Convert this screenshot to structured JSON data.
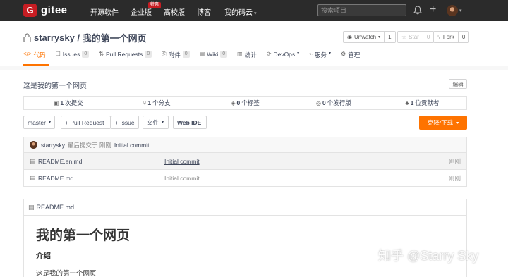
{
  "navbar": {
    "logo_glyph": "G",
    "logo_text": "gitee",
    "links": [
      "开源软件",
      "企业版",
      "高校版",
      "博客",
      "我的码云"
    ],
    "badge": "特惠",
    "search_placeholder": "搜索项目"
  },
  "repo": {
    "owner": "starrysky",
    "separator": " / ",
    "name": "我的第一个网页",
    "watch_label": "Unwatch",
    "watch_count": "1",
    "star_label": "Star",
    "star_count": "0",
    "fork_label": "Fork",
    "fork_count": "0"
  },
  "tabs": [
    {
      "label": "代码",
      "icon": "</>",
      "count": ""
    },
    {
      "label": "Issues",
      "icon": "☐",
      "count": "0"
    },
    {
      "label": "Pull Requests",
      "icon": "⇅",
      "count": "0"
    },
    {
      "label": "附件",
      "icon": "⎘",
      "count": "0"
    },
    {
      "label": "Wiki",
      "icon": "▤",
      "count": "0"
    },
    {
      "label": "统计",
      "icon": "▥",
      "count": ""
    },
    {
      "label": "DevOps",
      "icon": "⟳",
      "count": ""
    },
    {
      "label": "服务",
      "icon": "⌁",
      "count": ""
    },
    {
      "label": "管理",
      "icon": "⚙",
      "count": ""
    }
  ],
  "description": "这是我的第一个网页",
  "edit_label": "编辑",
  "stats": [
    {
      "icon": "▣",
      "value": "1",
      "label": "次提交"
    },
    {
      "icon": "⑂",
      "value": "1",
      "label": "个分支"
    },
    {
      "icon": "◈",
      "value": "0",
      "label": "个标签"
    },
    {
      "icon": "◎",
      "value": "0",
      "label": "个发行版"
    },
    {
      "icon": "♣",
      "value": "1",
      "label": "位贡献者"
    }
  ],
  "toolbar": {
    "branch": "master",
    "pull_request": "+ Pull Request",
    "issue": "+ Issue",
    "file": "文件",
    "web_ide": "Web IDE",
    "clone": "克隆/下载"
  },
  "commit": {
    "author": "starrysky",
    "meta": "最后提交于 刚刚",
    "message": "Initial commit"
  },
  "files": [
    {
      "name": "README.en.md",
      "commit": "Initial commit",
      "time": "刚刚"
    },
    {
      "name": "README.md",
      "commit": "Initial commit",
      "time": "刚刚"
    }
  ],
  "readme": {
    "filename": "README.md",
    "h1": "我的第一个网页",
    "h2": "介绍",
    "p": "这是我的第一个网页"
  },
  "watermark": "知乎 @Starry Sky",
  "colors": {
    "accent": "#fe7300",
    "navbar": "#2b2b2b",
    "brand": "#c71d23"
  }
}
